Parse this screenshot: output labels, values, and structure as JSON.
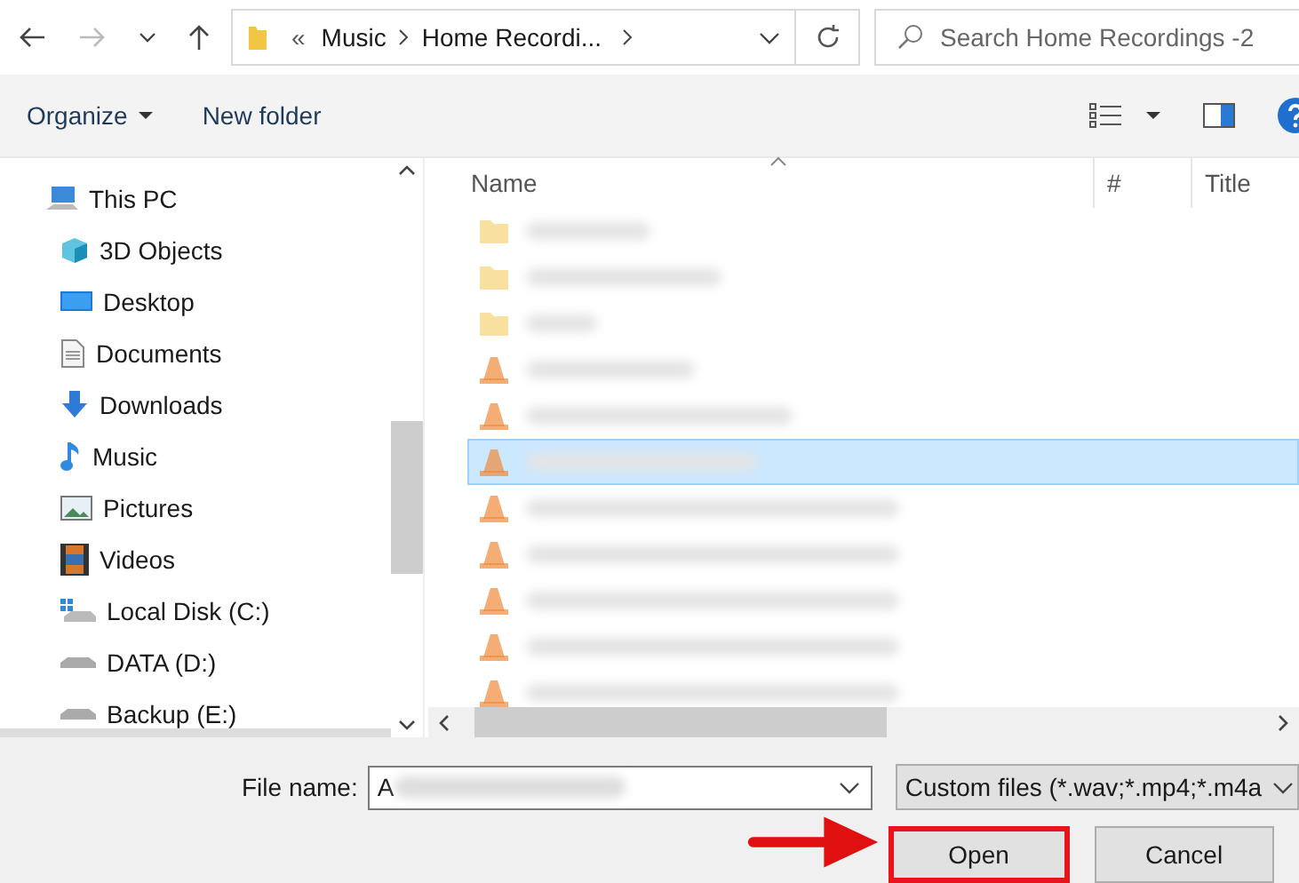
{
  "address_bar": {
    "breadcrumbs": [
      "«",
      "Music",
      "Home Recordi..."
    ]
  },
  "search": {
    "placeholder": "Search Home Recordings -2"
  },
  "toolbar": {
    "organize": "Organize",
    "new_folder": "New folder"
  },
  "sidebar": {
    "items": [
      {
        "label": "This PC",
        "kind": "pc",
        "children": [
          {
            "label": "3D Objects",
            "kind": "cube"
          },
          {
            "label": "Desktop",
            "kind": "desktop"
          },
          {
            "label": "Documents",
            "kind": "document"
          },
          {
            "label": "Downloads",
            "kind": "download"
          },
          {
            "label": "Music",
            "kind": "music"
          },
          {
            "label": "Pictures",
            "kind": "pictures"
          },
          {
            "label": "Videos",
            "kind": "videos"
          },
          {
            "label": "Local Disk (C:)",
            "kind": "system-drive"
          },
          {
            "label": "DATA (D:)",
            "kind": "drive"
          },
          {
            "label": "Backup (E:)",
            "kind": "drive"
          }
        ]
      }
    ]
  },
  "table": {
    "columns": [
      "Name",
      "#",
      "Title"
    ],
    "rows": [
      {
        "kind": "folder",
        "selected": false
      },
      {
        "kind": "folder",
        "selected": false
      },
      {
        "kind": "folder",
        "selected": false
      },
      {
        "kind": "media",
        "selected": false
      },
      {
        "kind": "media",
        "selected": false
      },
      {
        "kind": "media",
        "selected": true
      },
      {
        "kind": "media",
        "selected": false
      },
      {
        "kind": "media",
        "selected": false
      },
      {
        "kind": "media",
        "selected": false
      },
      {
        "kind": "media",
        "selected": false
      },
      {
        "kind": "media",
        "selected": false
      }
    ]
  },
  "file_name": {
    "label": "File name:",
    "value": "A"
  },
  "file_type": {
    "value": "Custom files (*.wav;*.mp4;*.m4a"
  },
  "buttons": [
    {
      "label": "Open",
      "highlighted": true
    },
    {
      "label": "Cancel",
      "highlighted": false
    }
  ]
}
